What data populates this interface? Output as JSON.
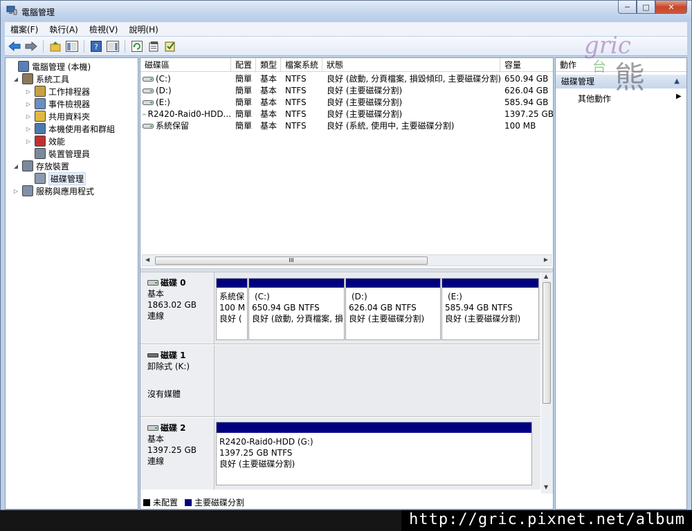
{
  "window": {
    "title": "電腦管理",
    "min": "─",
    "max": "□",
    "close": "✕"
  },
  "menu": [
    "檔案(F)",
    "執行(A)",
    "檢視(V)",
    "說明(H)"
  ],
  "tree": [
    {
      "label": "電腦管理 (本機)",
      "level": 0,
      "expander": "",
      "icon": "computer-management-icon",
      "icolor": "#5a7fb8"
    },
    {
      "label": "系統工具",
      "level": 1,
      "expander": "◢",
      "icon": "system-tools-icon",
      "icolor": "#8a7a5a"
    },
    {
      "label": "工作排程器",
      "level": 2,
      "expander": "▷",
      "icon": "task-scheduler-icon",
      "icolor": "#c9a040"
    },
    {
      "label": "事件檢視器",
      "level": 2,
      "expander": "▷",
      "icon": "event-viewer-icon",
      "icolor": "#6a8fc2"
    },
    {
      "label": "共用資料夾",
      "level": 2,
      "expander": "▷",
      "icon": "shared-folders-icon",
      "icolor": "#e0b840"
    },
    {
      "label": "本機使用者和群組",
      "level": 2,
      "expander": "▷",
      "icon": "users-groups-icon",
      "icolor": "#4a7ab0"
    },
    {
      "label": "效能",
      "level": 2,
      "expander": "▷",
      "icon": "performance-icon",
      "icolor": "#c03030"
    },
    {
      "label": "裝置管理員",
      "level": 2,
      "expander": "",
      "icon": "device-manager-icon",
      "icolor": "#7a8a9a"
    },
    {
      "label": "存放裝置",
      "level": 1,
      "expander": "◢",
      "icon": "storage-icon",
      "icolor": "#7a8aa0"
    },
    {
      "label": "磁碟管理",
      "level": 2,
      "expander": "",
      "icon": "disk-management-icon",
      "icolor": "#8a9ab0",
      "selected": true
    },
    {
      "label": "服務與應用程式",
      "level": 1,
      "expander": "▷",
      "icon": "services-apps-icon",
      "icolor": "#8090a8"
    }
  ],
  "volume_list": {
    "headers": [
      "磁碟區",
      "配置",
      "類型",
      "檔案系統",
      "狀態",
      "容量"
    ],
    "rows": [
      [
        "(C:)",
        "簡單",
        "基本",
        "NTFS",
        "良好 (啟動, 分頁檔案, 損毀傾印, 主要磁碟分割)",
        "650.94 GB"
      ],
      [
        "(D:)",
        "簡單",
        "基本",
        "NTFS",
        "良好 (主要磁碟分割)",
        "626.04 GB"
      ],
      [
        "(E:)",
        "簡單",
        "基本",
        "NTFS",
        "良好 (主要磁碟分割)",
        "585.94 GB"
      ],
      [
        "R2420-Raid0-HDD...",
        "簡單",
        "基本",
        "NTFS",
        "良好 (主要磁碟分割)",
        "1397.25 GB"
      ],
      [
        "系統保留",
        "簡單",
        "基本",
        "NTFS",
        "良好 (系統, 使用中, 主要磁碟分割)",
        "100 MB"
      ]
    ],
    "scroll_grip": "III"
  },
  "disks": [
    {
      "name": "磁碟 0",
      "type": "基本",
      "size": "1863.02 GB",
      "status": "連線",
      "partitions": [
        {
          "title": "系統保",
          "line2": "100 M",
          "line3": "良好 ("
        },
        {
          "title": "(C:)",
          "line2": "650.94 GB NTFS",
          "line3": "良好 (啟動, 分頁檔案, 損"
        },
        {
          "title": "(D:)",
          "line2": "626.04 GB NTFS",
          "line3": "良好 (主要磁碟分割)"
        },
        {
          "title": "(E:)",
          "line2": "585.94 GB NTFS",
          "line3": "良好 (主要磁碟分割)"
        }
      ]
    },
    {
      "name": "磁碟 1",
      "type": "卸除式 (K:)",
      "size": "",
      "status": "沒有媒體",
      "partitions": []
    },
    {
      "name": "磁碟 2",
      "type": "基本",
      "size": "1397.25 GB",
      "status": "連線",
      "partitions": [
        {
          "title": "R2420-Raid0-HDD  (G:)",
          "line2": "1397.25 GB NTFS",
          "line3": "良好 (主要磁碟分割)"
        }
      ]
    }
  ],
  "legend": [
    {
      "label": "未配置",
      "color": "#000000"
    },
    {
      "label": "主要磁碟分割",
      "color": "#00007f"
    }
  ],
  "actions": {
    "header": "動作",
    "section": "磁碟管理",
    "section_arrow": "▲",
    "item": "其他動作",
    "item_arrow": "▶"
  },
  "watermark": {
    "script": "gric",
    "zh1": "台",
    "zh2": "熊"
  },
  "footer": {
    "url": "http://gric.pixnet.net/album"
  }
}
